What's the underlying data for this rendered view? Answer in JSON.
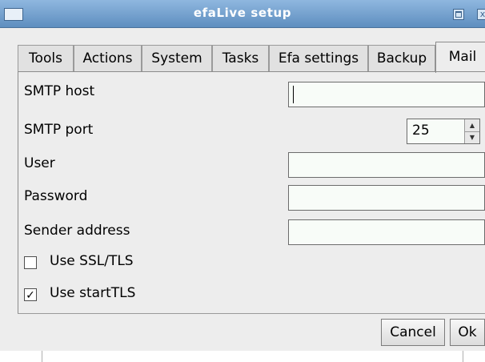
{
  "window": {
    "title": "efaLive setup"
  },
  "tabs": [
    {
      "label": "Tools"
    },
    {
      "label": "Actions"
    },
    {
      "label": "System"
    },
    {
      "label": "Tasks"
    },
    {
      "label": "Efa settings"
    },
    {
      "label": "Backup"
    },
    {
      "label": "Mail",
      "active": true
    }
  ],
  "mail": {
    "smtp_host": {
      "label": "SMTP host",
      "value": ""
    },
    "smtp_port": {
      "label": "SMTP port",
      "value": "25"
    },
    "user": {
      "label": "User",
      "value": ""
    },
    "password": {
      "label": "Password",
      "value": ""
    },
    "sender_address": {
      "label": "Sender address",
      "value": ""
    },
    "use_ssl_tls": {
      "label": "Use SSL/TLS",
      "checked": false
    },
    "use_starttls": {
      "label": "Use startTLS",
      "checked": true
    }
  },
  "buttons": {
    "cancel": "Cancel",
    "ok": "Ok"
  },
  "icons": {
    "checkbox_checked": "✓",
    "spin_up": "▲",
    "spin_down": "▼",
    "close": "x"
  },
  "colors": {
    "titlebar": "#6f9bc9",
    "window_bg": "#ededed",
    "field_bg": "#f8fcf8"
  }
}
